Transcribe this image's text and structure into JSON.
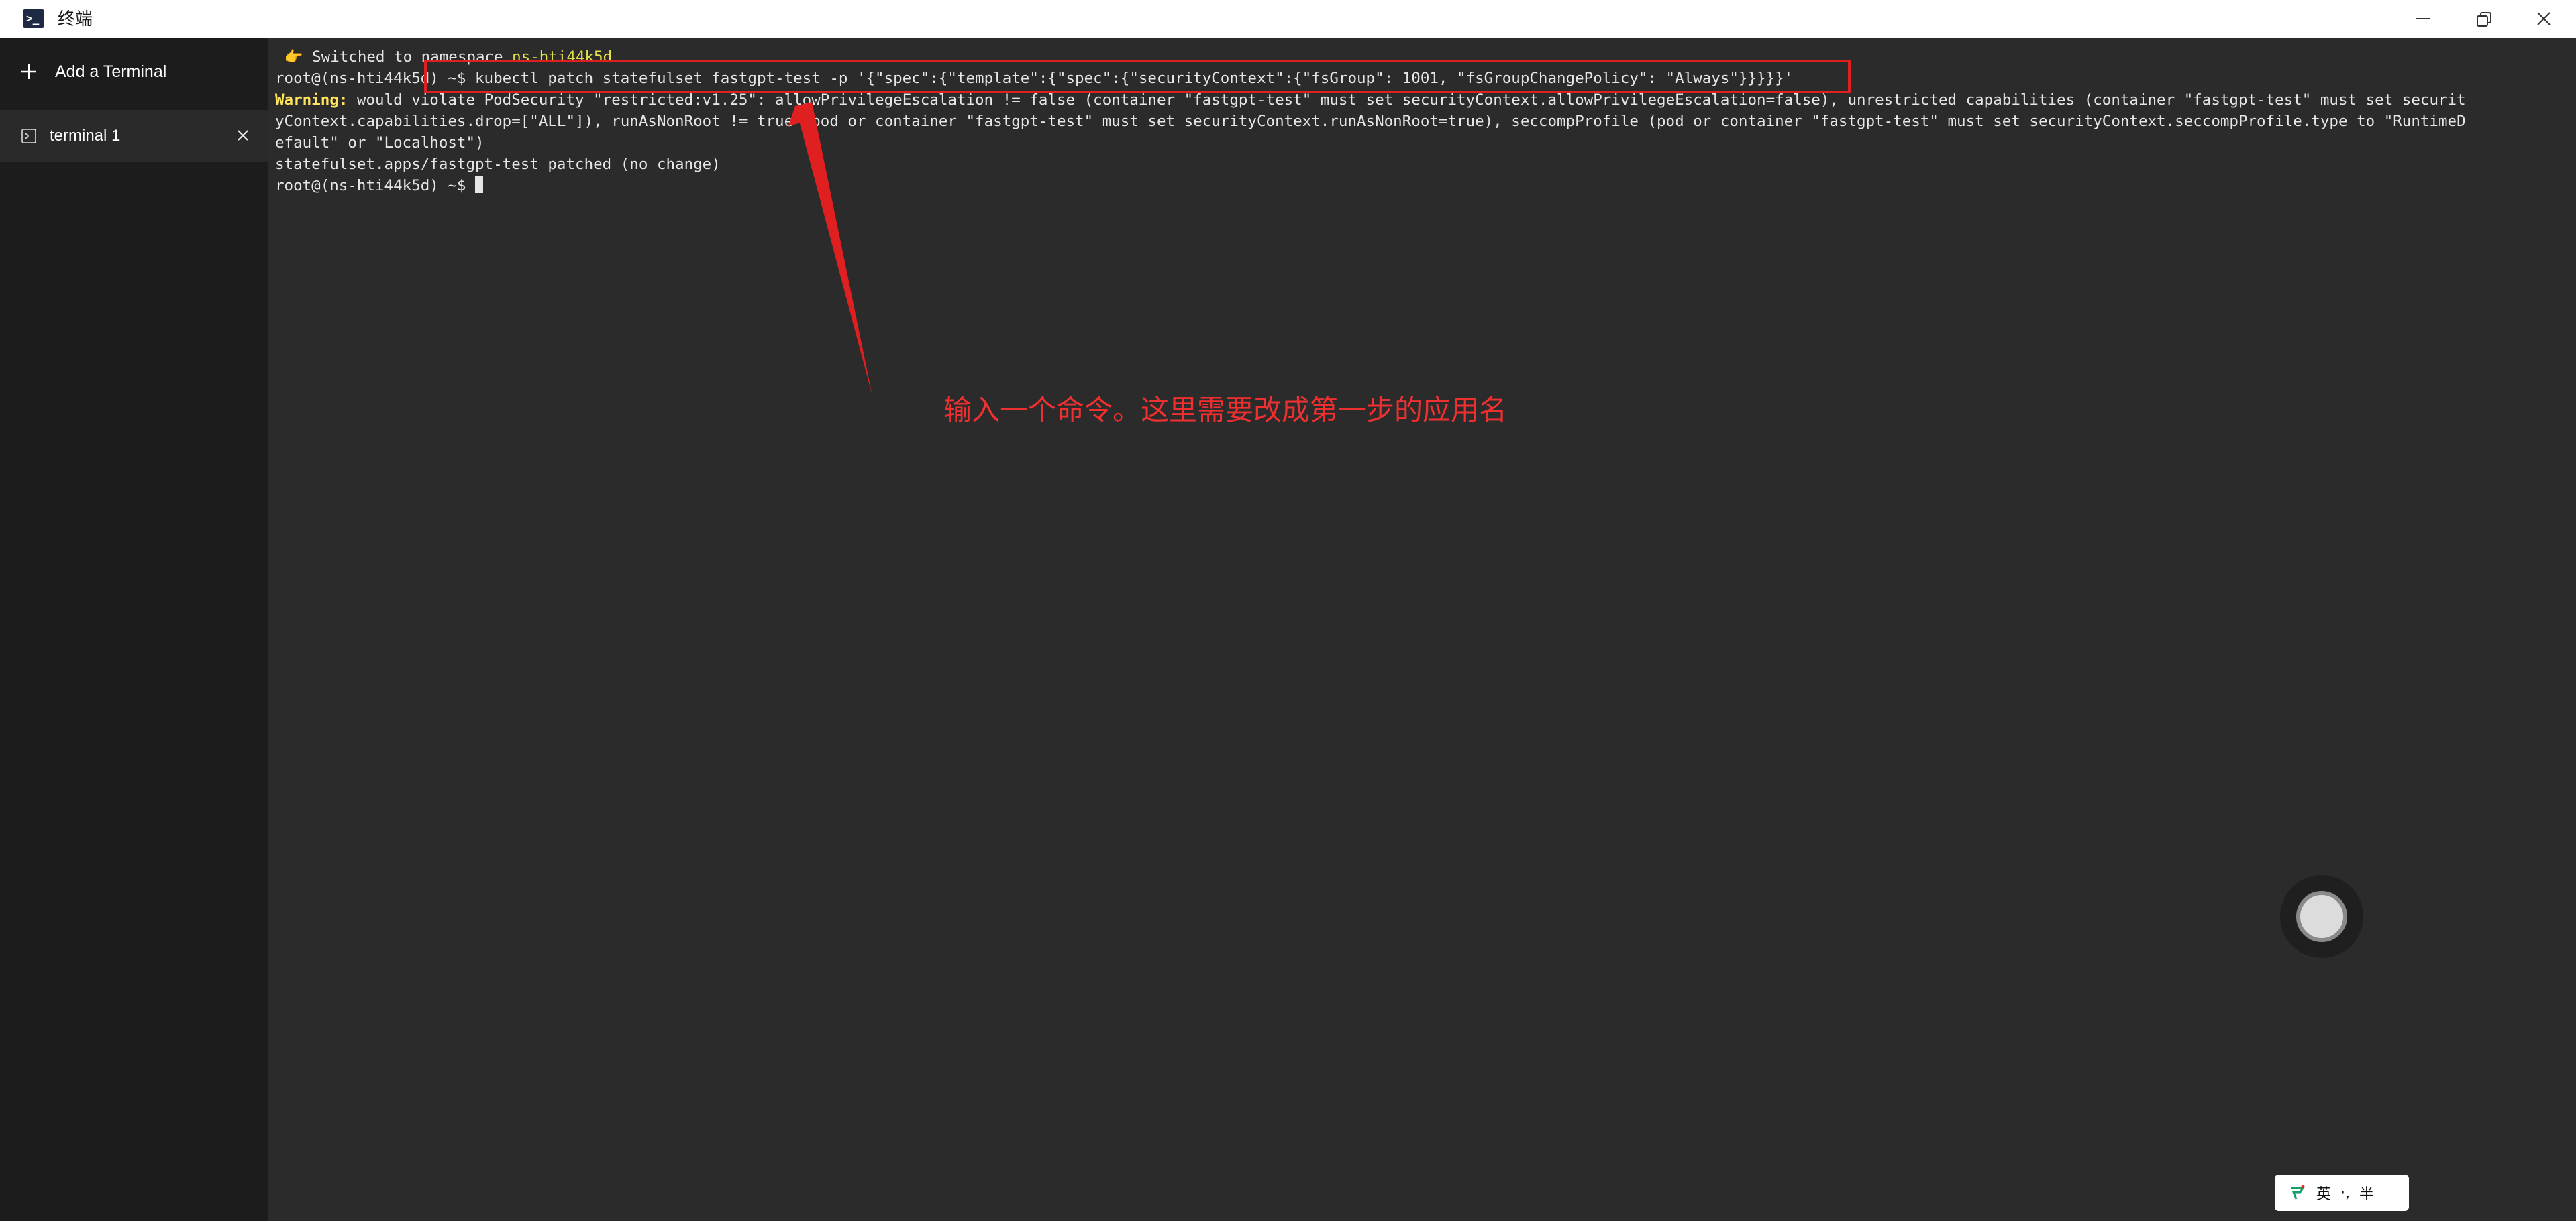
{
  "window": {
    "title": "终端",
    "icon": "terminal-app-icon"
  },
  "sidebar": {
    "add_label": "Add a Terminal",
    "tabs": [
      {
        "label": "terminal 1"
      }
    ]
  },
  "terminal": {
    "lines": [
      {
        "prefix": " 👉 Switched to namespace ",
        "highlight": "ns-hti44k5d"
      },
      {
        "text": "root@(ns-hti44k5d) ~$ kubectl patch statefulset fastgpt-test -p '{\"spec\":{\"template\":{\"spec\":{\"securityContext\":{\"fsGroup\": 1001, \"fsGroupChangePolicy\": \"Always\"}}}}}'"
      },
      {
        "label": "Warning:",
        "text": " would violate PodSecurity \"restricted:v1.25\": allowPrivilegeEscalation != false (container \"fastgpt-test\" must set securityContext.allowPrivilegeEscalation=false), unrestricted capabilities (container \"fastgpt-test\" must set securit"
      },
      {
        "text": "yContext.capabilities.drop=[\"ALL\"]), runAsNonRoot != true (pod or container \"fastgpt-test\" must set securityContext.runAsNonRoot=true), seccompProfile (pod or container \"fastgpt-test\" must set securityContext.seccompProfile.type to \"RuntimeD"
      },
      {
        "text": "efault\" or \"Localhost\")"
      },
      {
        "text": "statefulset.apps/fastgpt-test patched (no change)"
      },
      {
        "text": "root@(ns-hti44k5d) ~$ "
      }
    ]
  },
  "annotation": {
    "text": "输入一个命令。这里需要改成第一步的应用名",
    "color": "#f03030"
  },
  "ime": {
    "items": [
      "英",
      "·,",
      "半"
    ]
  },
  "colors": {
    "terminal_bg": "#2b2b2b",
    "sidebar_bg": "#1c1c1c",
    "accent_red": "#e02020",
    "warning_yellow": "#ffe65c"
  }
}
